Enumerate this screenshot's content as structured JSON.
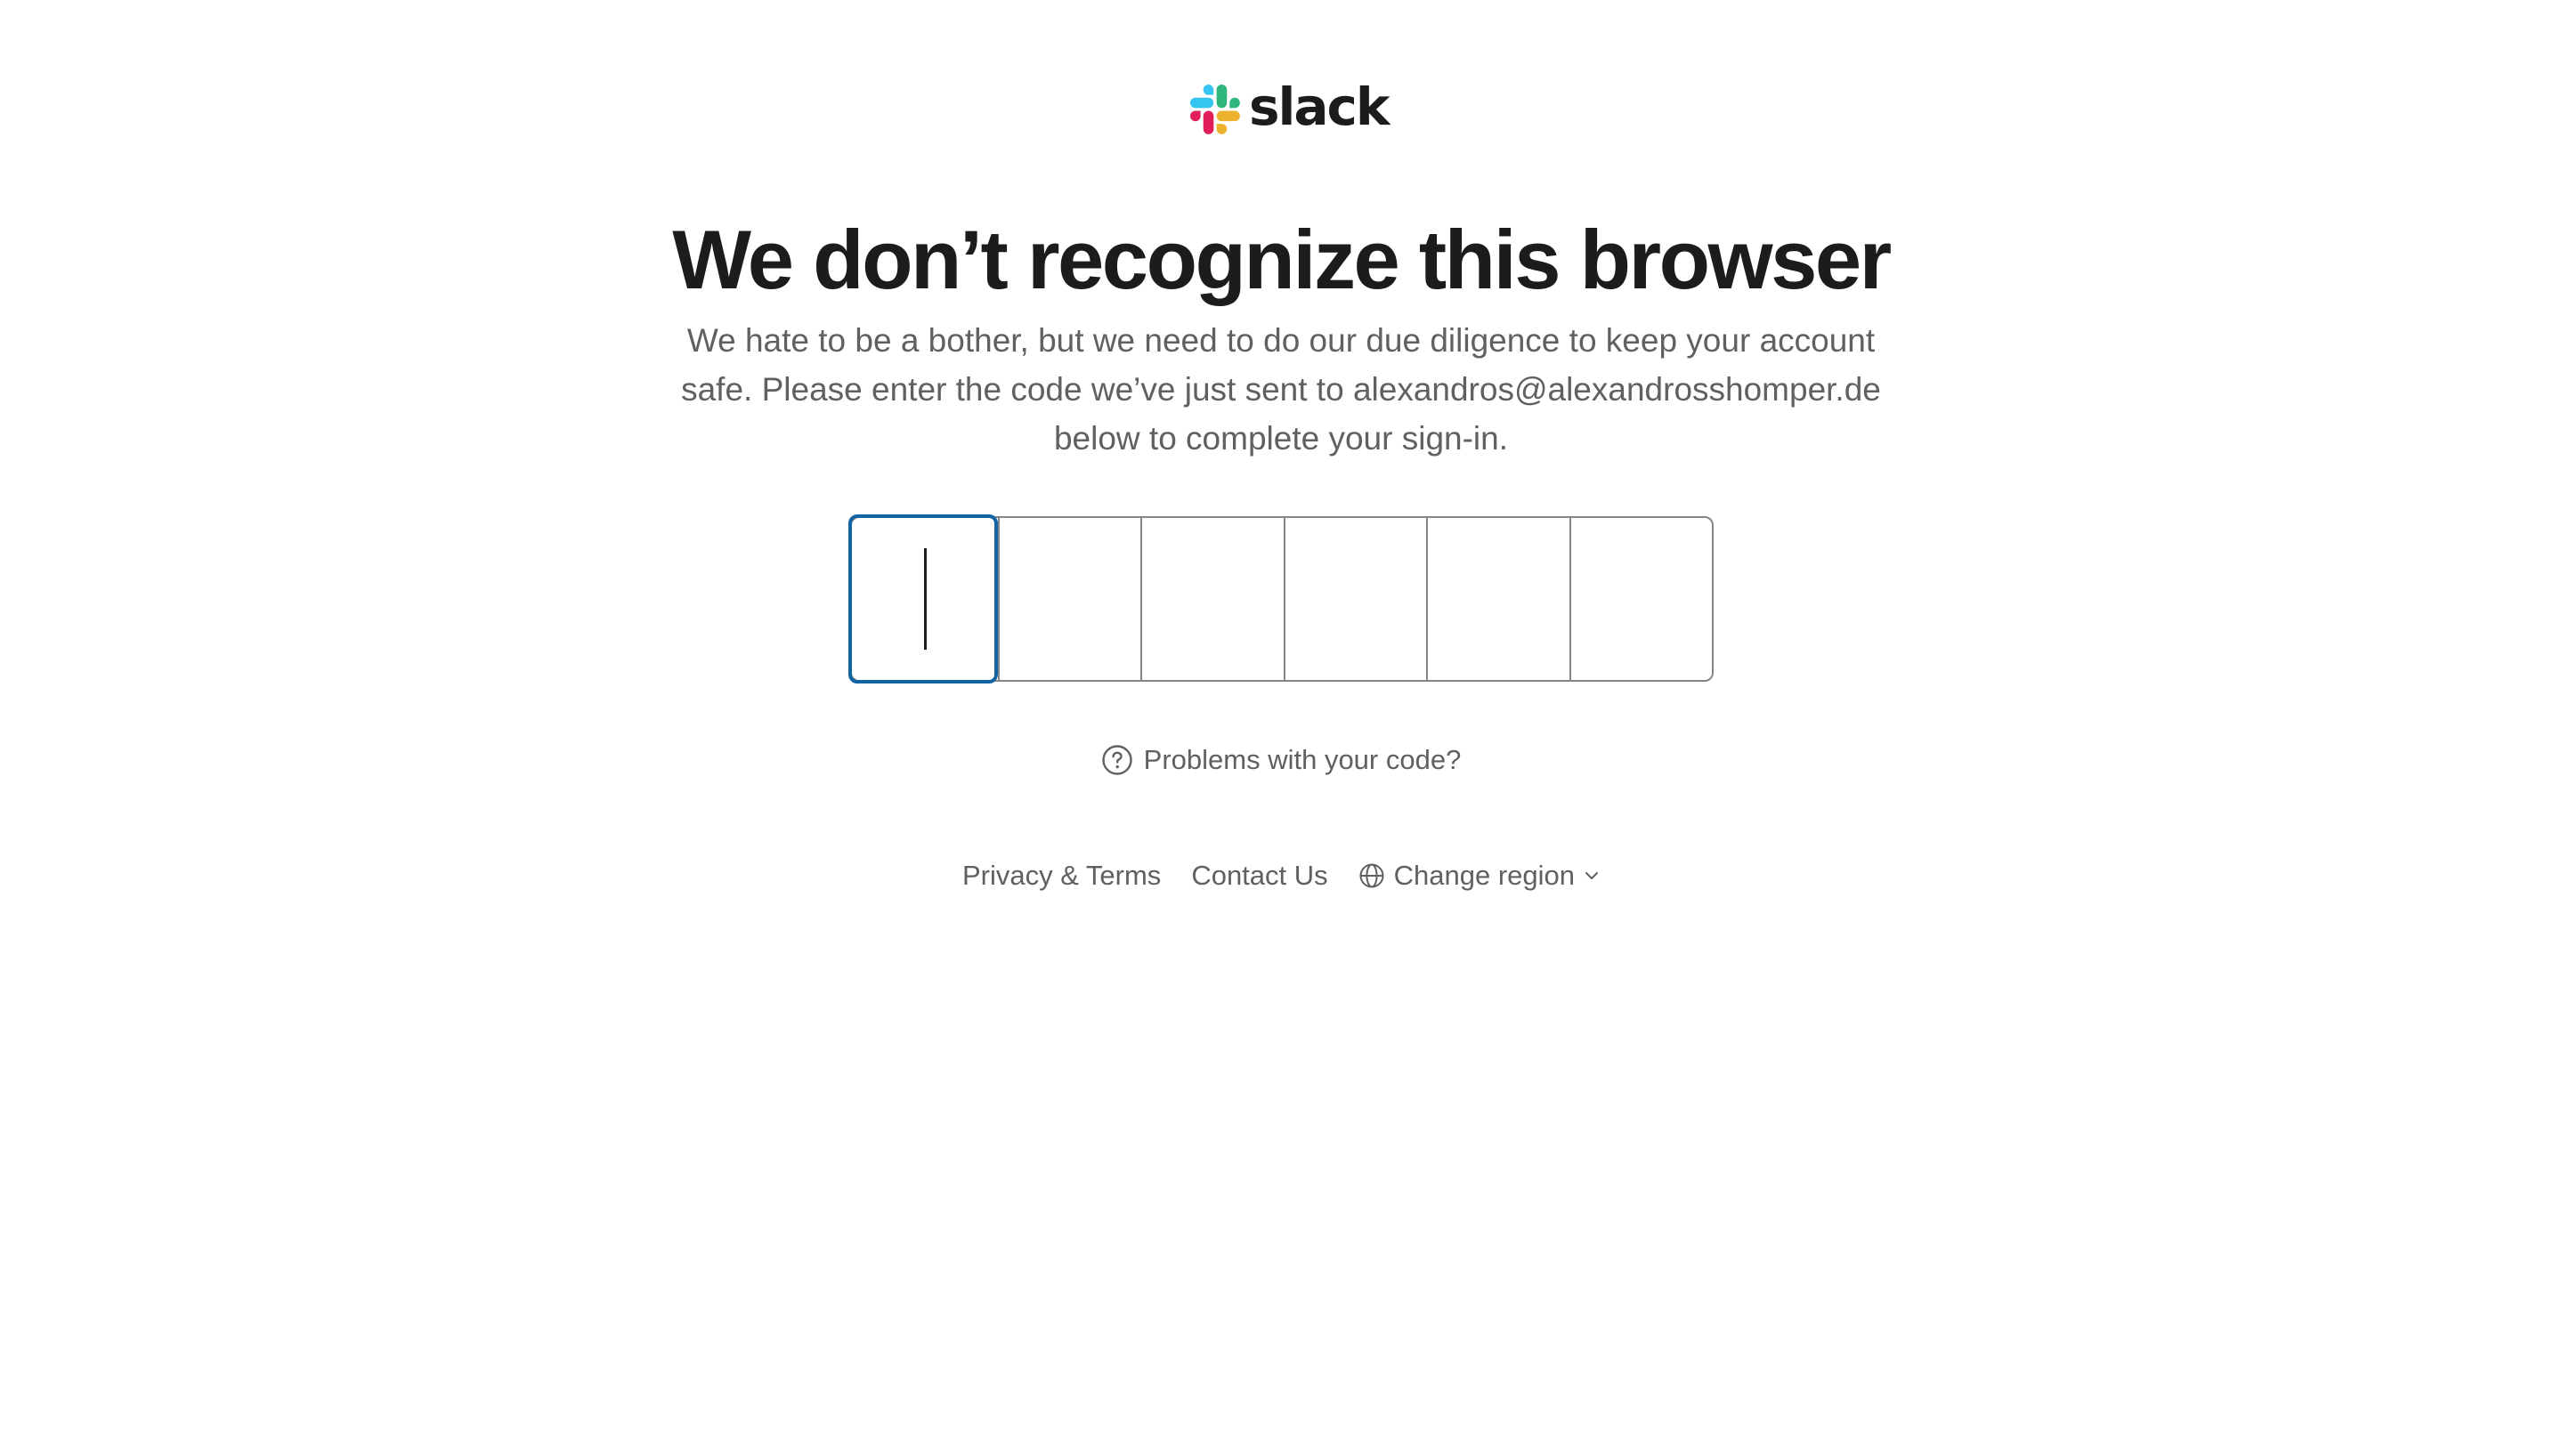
{
  "brand": {
    "name": "slack",
    "colors": {
      "blue": "#36C5F0",
      "green": "#2EB67D",
      "yellow": "#ECB22E",
      "red": "#E01E5A"
    },
    "icon": "slack-logo-icon"
  },
  "heading": "We don’t recognize this browser",
  "description": "We hate to be a bother, but we need to do our due diligence to keep your account safe. Please enter the code we’ve just sent to alexandros@alexandrosshomper.de below to complete your sign-in.",
  "code_input": {
    "digits": [
      "",
      "",
      "",
      "",
      "",
      ""
    ],
    "focused_index": 0,
    "focus_color": "#1264A3"
  },
  "help": {
    "label": "Problems with your code?",
    "icon": "question-circle-icon"
  },
  "footer": {
    "privacy_label": "Privacy & Terms",
    "contact_label": "Contact Us",
    "region_label": "Change region",
    "region_icon": "globe-icon",
    "dropdown_icon": "chevron-down-icon"
  }
}
